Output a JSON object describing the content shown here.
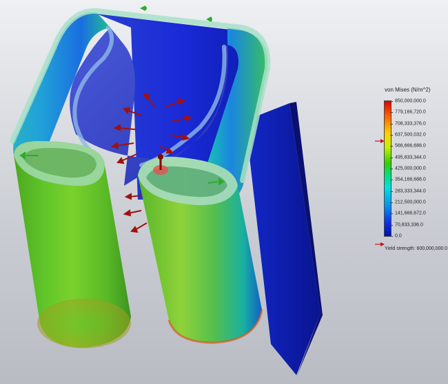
{
  "legend": {
    "title": "von Mises (N/m^2)",
    "ticks": [
      "850,000,000.0",
      "779,166,720.0",
      "708,333,376.0",
      "637,500,032.0",
      "566,666,688.0",
      "495,833,344.0",
      "425,000,000.0",
      "354,166,688.0",
      "283,333,344.0",
      "212,500,000.0",
      "141,666,672.0",
      "70,833,336.0",
      "0.0"
    ],
    "yield_label": "Yield strength: 600,000,000.0",
    "yield_fraction": 0.294,
    "colors": {
      "max": "#e00000",
      "mid": "#30d000",
      "min": "#0010b0",
      "marker": "#d01010"
    }
  },
  "model": {
    "load_arrow_color": "#a01010",
    "fixture_color": "#2ea82e",
    "icons": [
      "fixture-icon",
      "load-arrow-icon",
      "pin-fixture-icon"
    ]
  }
}
